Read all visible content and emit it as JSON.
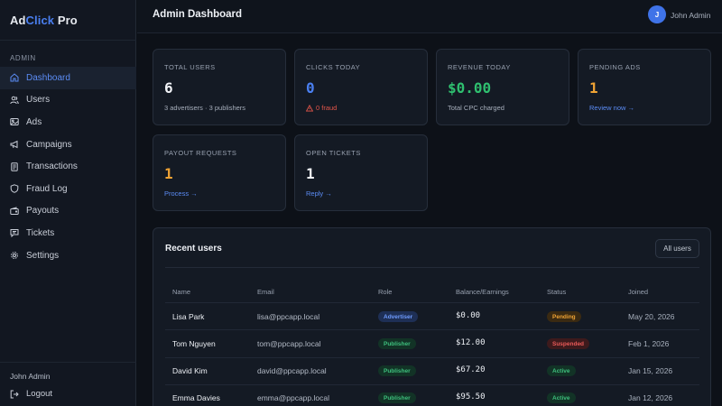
{
  "brand": {
    "part1": "Ad",
    "part2": "Click",
    "part3": " Pro"
  },
  "sidebar": {
    "section_label": "ADMIN",
    "items": [
      {
        "label": "Dashboard",
        "icon": "home-icon",
        "active": true
      },
      {
        "label": "Users",
        "icon": "users-icon",
        "active": false
      },
      {
        "label": "Ads",
        "icon": "image-icon",
        "active": false
      },
      {
        "label": "Campaigns",
        "icon": "megaphone-icon",
        "active": false
      },
      {
        "label": "Transactions",
        "icon": "receipt-icon",
        "active": false
      },
      {
        "label": "Fraud Log",
        "icon": "shield-icon",
        "active": false
      },
      {
        "label": "Payouts",
        "icon": "wallet-icon",
        "active": false
      },
      {
        "label": "Tickets",
        "icon": "message-icon",
        "active": false
      },
      {
        "label": "Settings",
        "icon": "gear-icon",
        "active": false
      }
    ],
    "user_name": "John Admin",
    "logout_label": "Logout"
  },
  "header": {
    "title": "Admin Dashboard",
    "avatar_initial": "J",
    "user_name": "John Admin"
  },
  "stats": {
    "total_users": {
      "label": "TOTAL USERS",
      "value": "6",
      "sub": "3 advertisers · 3 publishers"
    },
    "clicks_today": {
      "label": "CLICKS TODAY",
      "value": "0",
      "sub": "0 fraud"
    },
    "revenue_today": {
      "label": "REVENUE TODAY",
      "value": "$0.00",
      "sub": "Total CPC charged"
    },
    "pending_ads": {
      "label": "PENDING ADS",
      "value": "1",
      "link": "Review now →"
    },
    "payout_requests": {
      "label": "PAYOUT REQUESTS",
      "value": "1",
      "link": "Process →"
    },
    "open_tickets": {
      "label": "OPEN TICKETS",
      "value": "1",
      "link": "Reply →"
    }
  },
  "recent_users": {
    "title": "Recent users",
    "button_label": "All users",
    "columns": [
      "Name",
      "Email",
      "Role",
      "Balance/Earnings",
      "Status",
      "Joined"
    ],
    "rows": [
      {
        "name": "Lisa Park",
        "email": "lisa@ppcapp.local",
        "role": "Advertiser",
        "balance": "$0.00",
        "status": "Pending",
        "joined": "May 20, 2026"
      },
      {
        "name": "Tom Nguyen",
        "email": "tom@ppcapp.local",
        "role": "Publisher",
        "balance": "$12.00",
        "status": "Suspended",
        "joined": "Feb 1, 2026"
      },
      {
        "name": "David Kim",
        "email": "david@ppcapp.local",
        "role": "Publisher",
        "balance": "$67.20",
        "status": "Active",
        "joined": "Jan 15, 2026"
      },
      {
        "name": "Emma Davies",
        "email": "emma@ppcapp.local",
        "role": "Publisher",
        "balance": "$95.50",
        "status": "Active",
        "joined": "Jan 12, 2026"
      }
    ]
  },
  "colors": {
    "accent": "#4a7ff0",
    "success": "#2fbf6f",
    "warning": "#f0a334",
    "danger": "#e2554a"
  }
}
